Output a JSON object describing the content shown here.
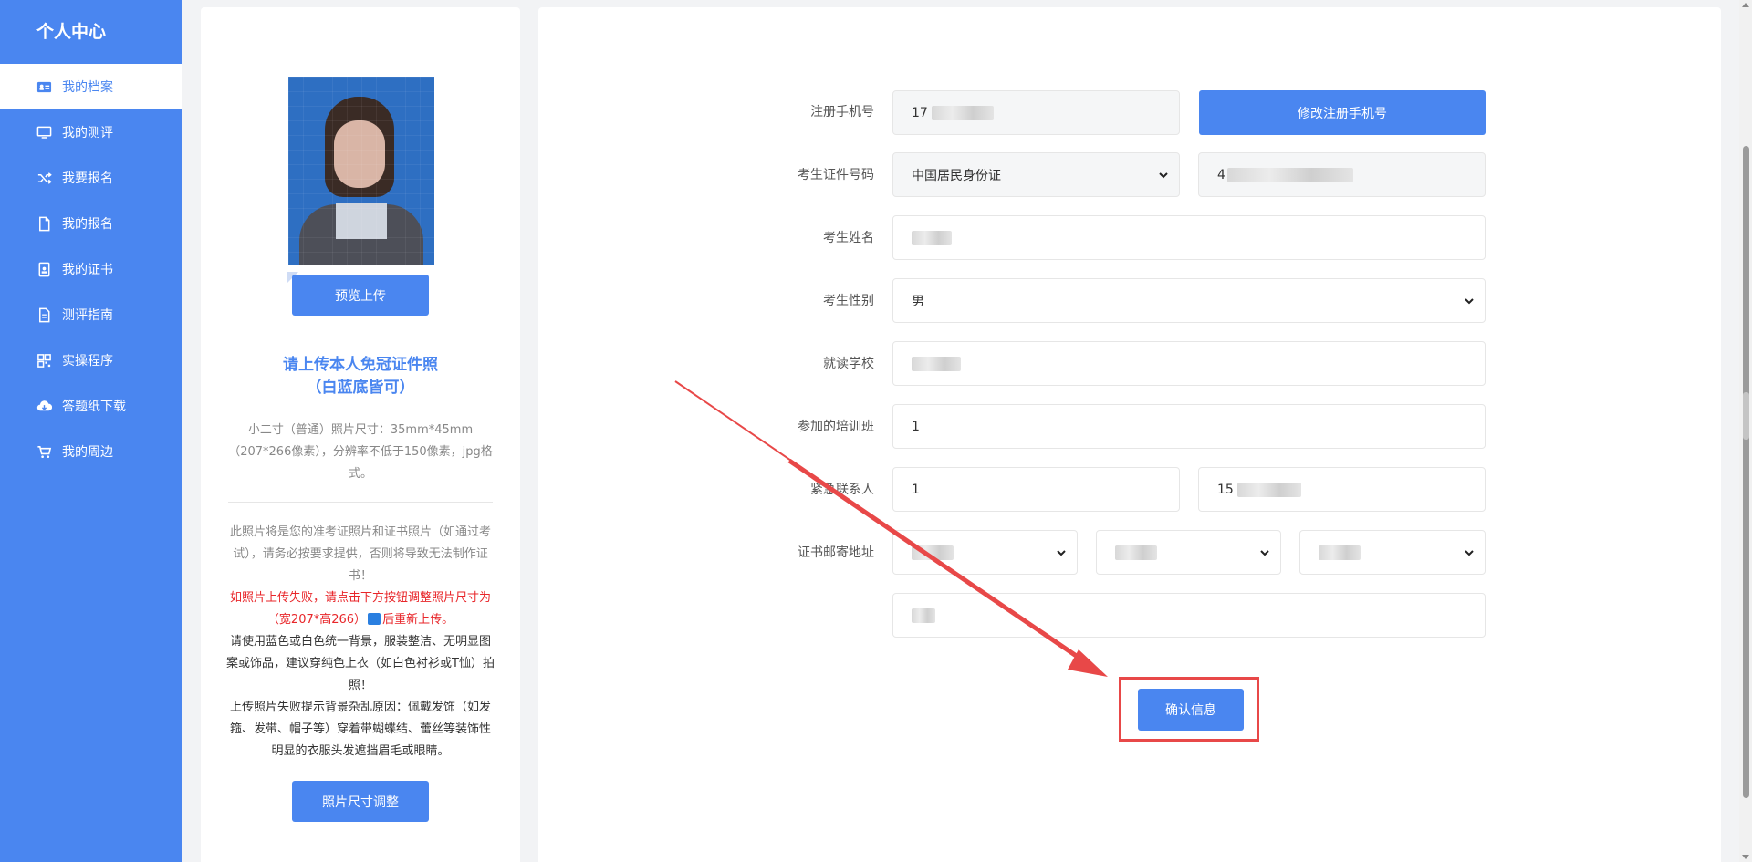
{
  "sidebar": {
    "title": "个人中心",
    "items": [
      {
        "label": "我的档案",
        "icon": "id-card-icon",
        "active": true
      },
      {
        "label": "我的测评",
        "icon": "monitor-icon",
        "active": false
      },
      {
        "label": "我要报名",
        "icon": "shuffle-icon",
        "active": false
      },
      {
        "label": "我的报名",
        "icon": "file-icon",
        "active": false
      },
      {
        "label": "我的证书",
        "icon": "certificate-icon",
        "active": false
      },
      {
        "label": "测评指南",
        "icon": "document-icon",
        "active": false
      },
      {
        "label": "实操程序",
        "icon": "qrcode-icon",
        "active": false
      },
      {
        "label": "答题纸下载",
        "icon": "cloud-download-icon",
        "active": false
      },
      {
        "label": "我的周边",
        "icon": "cart-icon",
        "active": false
      }
    ]
  },
  "photo_panel": {
    "preview_button": "预览上传",
    "upload_title_line1": "请上传本人免冠证件照",
    "upload_title_line2": "（白蓝底皆可）",
    "spec_text": "小二寸（普通）照片尺寸：35mm*45mm（207*266像素），分辨率不低于150像素，jpg格式。",
    "note_gray": "此照片将是您的准考证照片和证书照片（如通过考试），请务必按要求提供，否则将导致无法制作证书！",
    "note_red_before_icon": "如照片上传失败，请点击下方按钮调整照片尺寸为（宽207*高266）",
    "note_red_after_icon": "后重新上传。",
    "note_dark_1": "请使用蓝色或白色统一背景，服装整洁、无明显图案或饰品，建议穿纯色上衣（如白色衬衫或T恤）拍照！",
    "note_dark_2": "上传照片失败提示背景杂乱原因：佩戴发饰（如发箍、发带、帽子等）穿着带蝴蝶结、蕾丝等装饰性明显的衣服头发遮挡眉毛或眼睛。",
    "resize_button": "照片尺寸调整"
  },
  "form": {
    "phone_label": "注册手机号",
    "phone_value_prefix": "17",
    "change_phone_button": "修改注册手机号",
    "id_label": "考生证件号码",
    "id_type_value": "中国居民身份证",
    "id_number_prefix": "4",
    "name_label": "考生姓名",
    "gender_label": "考生性别",
    "gender_value": "男",
    "school_label": "就读学校",
    "training_label": "参加的培训班",
    "training_value": "1",
    "emergency_label": "紧急联系人",
    "emergency_name_value": "1",
    "emergency_phone_prefix": "15",
    "address_label": "证书邮寄地址",
    "confirm_button": "确认信息"
  },
  "colors": {
    "accent": "#4a86f0",
    "highlight_red": "#e84848"
  }
}
